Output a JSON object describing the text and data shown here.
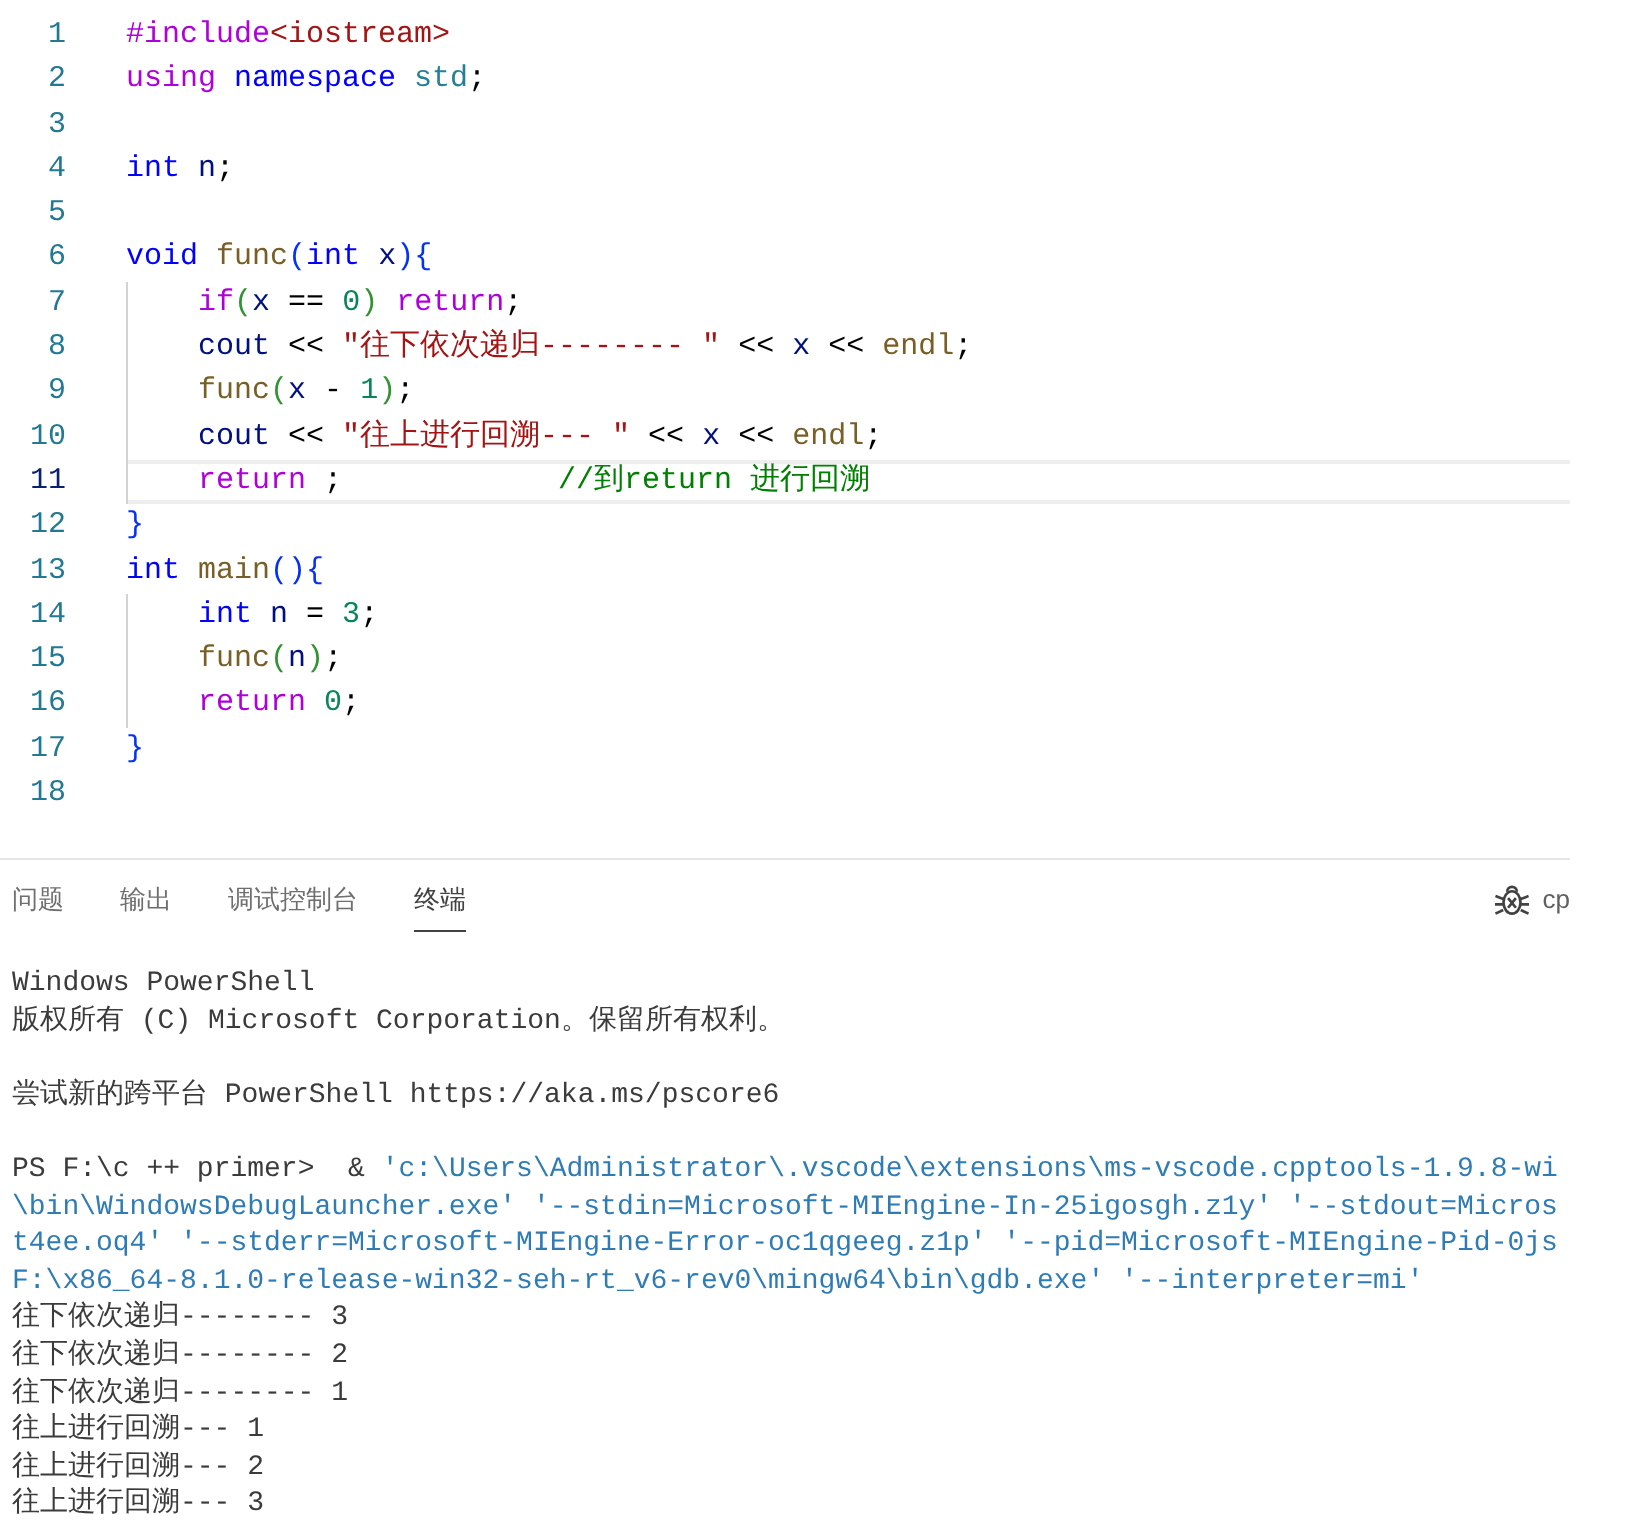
{
  "editor": {
    "lines": [
      {
        "number": "1",
        "current": false,
        "tokens": [
          {
            "text": "#include",
            "kind": "directive"
          },
          {
            "text": "<iostream>",
            "kind": "string"
          }
        ]
      },
      {
        "number": "2",
        "current": false,
        "tokens": [
          {
            "text": "using ",
            "kind": "control"
          },
          {
            "text": "namespace ",
            "kind": "keyword"
          },
          {
            "text": "std",
            "kind": "type"
          },
          {
            "text": ";",
            "kind": "plain"
          }
        ]
      },
      {
        "number": "3",
        "current": false
      },
      {
        "number": "4",
        "current": false,
        "tokens": [
          {
            "text": "int ",
            "kind": "keyword"
          },
          {
            "text": "n",
            "kind": "variable"
          },
          {
            "text": ";",
            "kind": "plain"
          }
        ]
      },
      {
        "number": "5",
        "current": false
      },
      {
        "number": "6",
        "current": false,
        "tokens": [
          {
            "text": "void ",
            "kind": "keyword"
          },
          {
            "text": "func",
            "kind": "function"
          },
          {
            "text": "(",
            "kind": "bracket1"
          },
          {
            "text": "int ",
            "kind": "keyword"
          },
          {
            "text": "x",
            "kind": "variable"
          },
          {
            "text": ")",
            "kind": "bracket1"
          },
          {
            "text": "{",
            "kind": "bracket1"
          }
        ],
        "children": [
          {
            "number": "7",
            "current": false,
            "tokens": [
              {
                "text": "if",
                "kind": "control"
              },
              {
                "text": "(",
                "kind": "bracket2"
              },
              {
                "text": "x",
                "kind": "variable"
              },
              {
                "text": " == ",
                "kind": "plain"
              },
              {
                "text": "0",
                "kind": "number"
              },
              {
                "text": ")",
                "kind": "bracket2"
              },
              {
                "text": " return",
                "kind": "control"
              },
              {
                "text": ";",
                "kind": "plain"
              }
            ]
          },
          {
            "number": "8",
            "current": false,
            "tokens": [
              {
                "text": "cout",
                "kind": "variable"
              },
              {
                "text": " << ",
                "kind": "plain"
              },
              {
                "text": "\"往下依次递归-------- \"",
                "kind": "string"
              },
              {
                "text": " << ",
                "kind": "plain"
              },
              {
                "text": "x",
                "kind": "variable"
              },
              {
                "text": " << ",
                "kind": "plain"
              },
              {
                "text": "endl",
                "kind": "function"
              },
              {
                "text": ";",
                "kind": "plain"
              }
            ]
          },
          {
            "number": "9",
            "current": false,
            "tokens": [
              {
                "text": "func",
                "kind": "function"
              },
              {
                "text": "(",
                "kind": "bracket2"
              },
              {
                "text": "x",
                "kind": "variable"
              },
              {
                "text": " - ",
                "kind": "plain"
              },
              {
                "text": "1",
                "kind": "number"
              },
              {
                "text": ")",
                "kind": "bracket2"
              },
              {
                "text": ";",
                "kind": "plain"
              }
            ]
          },
          {
            "number": "10",
            "current": false,
            "tokens": [
              {
                "text": "cout",
                "kind": "variable"
              },
              {
                "text": " << ",
                "kind": "plain"
              },
              {
                "text": "\"往上进行回溯--- \"",
                "kind": "string"
              },
              {
                "text": " << ",
                "kind": "plain"
              },
              {
                "text": "x",
                "kind": "variable"
              },
              {
                "text": " << ",
                "kind": "plain"
              },
              {
                "text": "endl",
                "kind": "function"
              },
              {
                "text": ";",
                "kind": "plain"
              }
            ]
          },
          {
            "number": "11",
            "current": true,
            "tokens": [
              {
                "text": "return",
                "kind": "control"
              },
              {
                "text": " ;            ",
                "kind": "plain"
              },
              {
                "text": "//到return 进行回溯",
                "kind": "comment"
              }
            ]
          }
        ]
      },
      {
        "number": "12",
        "current": false,
        "tokens": [
          {
            "text": "}",
            "kind": "bracket1"
          }
        ]
      },
      {
        "number": "13",
        "current": false,
        "tokens": [
          {
            "text": "int ",
            "kind": "keyword"
          },
          {
            "text": "main",
            "kind": "function"
          },
          {
            "text": "()",
            "kind": "bracket1"
          },
          {
            "text": "{",
            "kind": "bracket1"
          }
        ],
        "children": [
          {
            "number": "14",
            "current": false,
            "tokens": [
              {
                "text": "int ",
                "kind": "keyword"
              },
              {
                "text": "n",
                "kind": "variable"
              },
              {
                "text": " = ",
                "kind": "plain"
              },
              {
                "text": "3",
                "kind": "number"
              },
              {
                "text": ";",
                "kind": "plain"
              }
            ]
          },
          {
            "number": "15",
            "current": false,
            "tokens": [
              {
                "text": "func",
                "kind": "function"
              },
              {
                "text": "(",
                "kind": "bracket2"
              },
              {
                "text": "n",
                "kind": "variable"
              },
              {
                "text": ")",
                "kind": "bracket2"
              },
              {
                "text": ";",
                "kind": "plain"
              }
            ]
          },
          {
            "number": "16",
            "current": false,
            "tokens": [
              {
                "text": "return ",
                "kind": "control"
              },
              {
                "text": "0",
                "kind": "number"
              },
              {
                "text": ";",
                "kind": "plain"
              }
            ]
          }
        ]
      },
      {
        "number": "17",
        "current": false,
        "tokens": [
          {
            "text": "}",
            "kind": "bracket1"
          }
        ]
      },
      {
        "number": "18",
        "current": false
      }
    ]
  },
  "panel": {
    "tabs": [
      {
        "label": "问题",
        "selected": false
      },
      {
        "label": "输出",
        "selected": false
      },
      {
        "label": "调试控制台",
        "selected": false
      },
      {
        "label": "终端",
        "selected": true
      }
    ],
    "terminal_selector": {
      "label": "cp"
    }
  },
  "terminal": {
    "blocks": [
      [
        {
          "kind": "output",
          "text": "Windows PowerShell"
        },
        {
          "kind": "output",
          "text": "版权所有 (C) Microsoft Corporation。保留所有权利。"
        }
      ],
      [
        {
          "kind": "output",
          "text": "尝试新的跨平台 PowerShell https://aka.ms/pscore6"
        }
      ],
      [
        {
          "kind": "command",
          "prompt": "PS F:\\c ++ primer>  & ",
          "text": "'c:\\Users\\Administrator\\.vscode\\extensions\\ms-vscode.cpptools-1.9.8-wi"
        },
        {
          "kind": "command",
          "text": "\\bin\\WindowsDebugLauncher.exe' '--stdin=Microsoft-MIEngine-In-25igosgh.z1y' '--stdout=Micros"
        },
        {
          "kind": "command",
          "text": "t4ee.oq4' '--stderr=Microsoft-MIEngine-Error-oc1qgeeg.z1p' '--pid=Microsoft-MIEngine-Pid-0js"
        },
        {
          "kind": "command",
          "text": "F:\\x86_64-8.1.0-release-win32-seh-rt_v6-rev0\\mingw64\\bin\\gdb.exe' '--interpreter=mi'"
        },
        {
          "kind": "output",
          "text": "往下依次递归-------- 3"
        },
        {
          "kind": "output",
          "text": "往下依次递归-------- 2"
        },
        {
          "kind": "output",
          "text": "往下依次递归-------- 1"
        },
        {
          "kind": "output",
          "text": "往上进行回溯--- 1"
        },
        {
          "kind": "output",
          "text": "往上进行回溯--- 2"
        },
        {
          "kind": "output",
          "text": "往上进行回溯--- 3"
        }
      ]
    ]
  }
}
